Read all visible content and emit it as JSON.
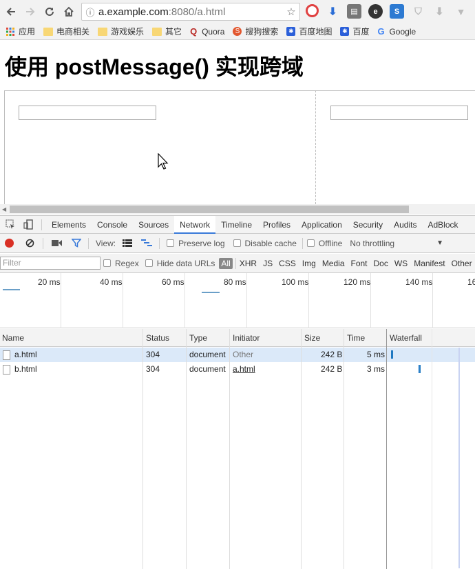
{
  "browser": {
    "url_host": "a.example.com",
    "url_port_path": ":8080/a.html",
    "bookmarks": [
      {
        "label": "应用",
        "icon": "apps-grid-icon"
      },
      {
        "label": "电商相关",
        "icon": "folder-icon"
      },
      {
        "label": "游戏娱乐",
        "icon": "folder-icon"
      },
      {
        "label": "其它",
        "icon": "folder-icon"
      },
      {
        "label": "Quora",
        "icon": "quora-icon"
      },
      {
        "label": "搜狗搜索",
        "icon": "sogou-icon"
      },
      {
        "label": "百度地图",
        "icon": "baidu-paw-icon"
      },
      {
        "label": "百度",
        "icon": "baidu-paw-icon"
      },
      {
        "label": "Google",
        "icon": "google-icon"
      }
    ]
  },
  "page": {
    "title": "使用 postMessage() 实现跨域"
  },
  "devtools": {
    "tabs": [
      "Elements",
      "Console",
      "Sources",
      "Network",
      "Timeline",
      "Profiles",
      "Application",
      "Security",
      "Audits",
      "AdBlock"
    ],
    "active_tab": "Network",
    "toolbar": {
      "view_label": "View:",
      "preserve_log": "Preserve log",
      "disable_cache": "Disable cache",
      "offline": "Offline",
      "throttling": "No throttling"
    },
    "filter": {
      "placeholder": "Filter",
      "regex": "Regex",
      "hide_data_urls": "Hide data URLs",
      "types": [
        "All",
        "XHR",
        "JS",
        "CSS",
        "Img",
        "Media",
        "Font",
        "Doc",
        "WS",
        "Manifest",
        "Other"
      ]
    },
    "overview_ticks": [
      "20 ms",
      "40 ms",
      "60 ms",
      "80 ms",
      "100 ms",
      "120 ms",
      "140 ms",
      "16"
    ],
    "columns": [
      "Name",
      "Status",
      "Type",
      "Initiator",
      "Size",
      "Time",
      "Waterfall"
    ],
    "rows": [
      {
        "name": "a.html",
        "status": "304",
        "type": "document",
        "initiator": "Other",
        "size": "242 B",
        "time": "5 ms"
      },
      {
        "name": "b.html",
        "status": "304",
        "type": "document",
        "initiator": "a.html",
        "size": "242 B",
        "time": "3 ms"
      }
    ]
  },
  "colors": {
    "accent": "#3879d9",
    "record": "#d93025",
    "waterfall": "#1f78c1"
  }
}
